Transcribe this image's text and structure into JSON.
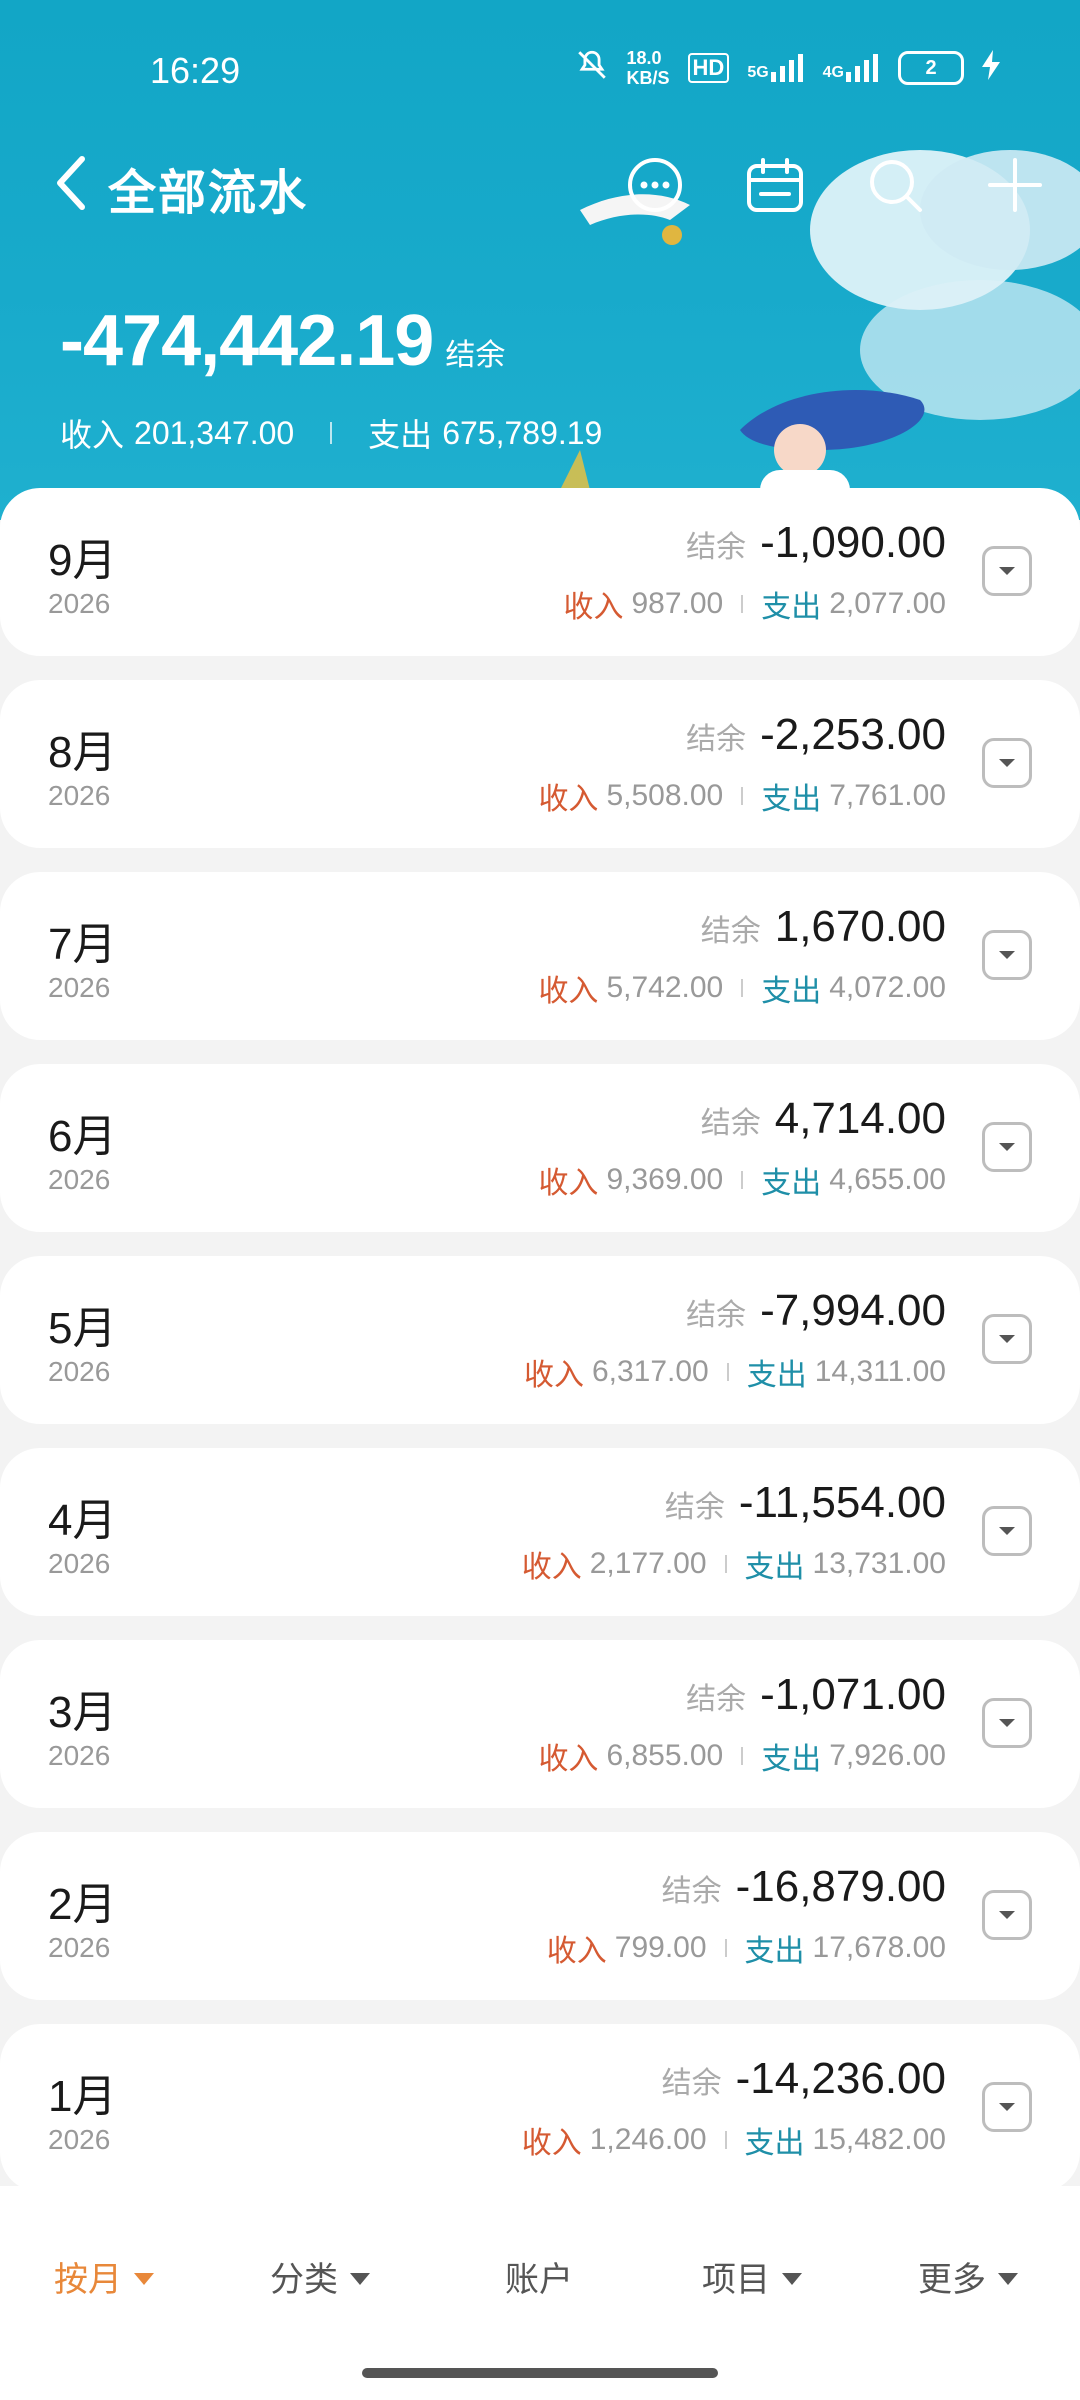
{
  "status": {
    "time": "16:29",
    "net_speed_top": "18.0",
    "net_speed_bottom": "KB/S",
    "hd": "HD",
    "signal_5g": "5G",
    "signal_4g": "4G",
    "battery": "2"
  },
  "nav": {
    "title": "全部流水",
    "icons": [
      "more-icon",
      "calendar-icon",
      "search-icon",
      "add-icon"
    ]
  },
  "summary": {
    "balance": "-474,442.19",
    "balance_label": "结余",
    "income_label": "收入",
    "income": "201,347.00",
    "expense_label": "支出",
    "expense": "675,789.19"
  },
  "months": [
    {
      "month": "9月",
      "year": "2026",
      "balance_label": "结余",
      "balance": "-1,090.00",
      "income_label": "收入",
      "income": "987.00",
      "expense_label": "支出",
      "expense": "2,077.00"
    },
    {
      "month": "8月",
      "year": "2026",
      "balance_label": "结余",
      "balance": "-2,253.00",
      "income_label": "收入",
      "income": "5,508.00",
      "expense_label": "支出",
      "expense": "7,761.00"
    },
    {
      "month": "7月",
      "year": "2026",
      "balance_label": "结余",
      "balance": "1,670.00",
      "income_label": "收入",
      "income": "5,742.00",
      "expense_label": "支出",
      "expense": "4,072.00"
    },
    {
      "month": "6月",
      "year": "2026",
      "balance_label": "结余",
      "balance": "4,714.00",
      "income_label": "收入",
      "income": "9,369.00",
      "expense_label": "支出",
      "expense": "4,655.00"
    },
    {
      "month": "5月",
      "year": "2026",
      "balance_label": "结余",
      "balance": "-7,994.00",
      "income_label": "收入",
      "income": "6,317.00",
      "expense_label": "支出",
      "expense": "14,311.00"
    },
    {
      "month": "4月",
      "year": "2026",
      "balance_label": "结余",
      "balance": "-11,554.00",
      "income_label": "收入",
      "income": "2,177.00",
      "expense_label": "支出",
      "expense": "13,731.00"
    },
    {
      "month": "3月",
      "year": "2026",
      "balance_label": "结余",
      "balance": "-1,071.00",
      "income_label": "收入",
      "income": "6,855.00",
      "expense_label": "支出",
      "expense": "7,926.00"
    },
    {
      "month": "2月",
      "year": "2026",
      "balance_label": "结余",
      "balance": "-16,879.00",
      "income_label": "收入",
      "income": "799.00",
      "expense_label": "支出",
      "expense": "17,678.00"
    },
    {
      "month": "1月",
      "year": "2026",
      "balance_label": "结余",
      "balance": "-14,236.00",
      "income_label": "收入",
      "income": "1,246.00",
      "expense_label": "支出",
      "expense": "15,482.00"
    }
  ],
  "tabs": [
    {
      "label": "按月",
      "active": true,
      "caret": true
    },
    {
      "label": "分类",
      "active": false,
      "caret": true
    },
    {
      "label": "账户",
      "active": false,
      "caret": false
    },
    {
      "label": "项目",
      "active": false,
      "caret": true
    },
    {
      "label": "更多",
      "active": false,
      "caret": true
    }
  ],
  "colors": {
    "header": "#18aacb",
    "income": "#d55a32",
    "expense": "#1f8fa8",
    "active_tab": "#e8883a"
  }
}
